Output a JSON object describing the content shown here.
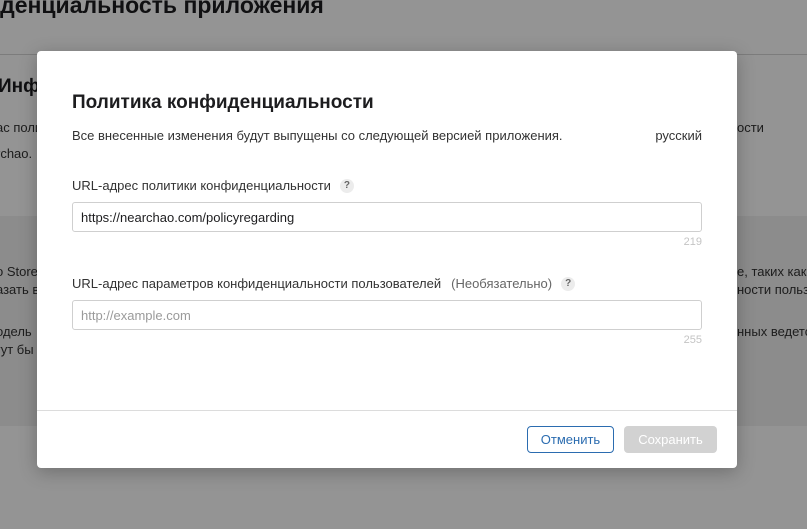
{
  "background": {
    "page_title": "иденциальность приложения",
    "section_title": "Инфо",
    "fragments_left": [
      "ас поли",
      "rchao.",
      "o Store",
      "азать в",
      "одель",
      "гут бы"
    ],
    "fragments_right": [
      "ости",
      "е, таких как",
      "ности польз",
      "нных ведетс"
    ]
  },
  "modal": {
    "title": "Политика конфиденциальности",
    "description": "Все внесенные изменения будут выпущены со следующей версией приложения.",
    "language": "русский",
    "field1": {
      "label": "URL-адрес политики конфиденциальности",
      "help": "?",
      "value": "https://nearchao.com/policyregarding",
      "counter": "219"
    },
    "field2": {
      "label": "URL-адрес параметров конфиденциальности пользователей",
      "optional": "(Необязательно)",
      "help": "?",
      "placeholder": "http://example.com",
      "counter": "255"
    },
    "cancel_label": "Отменить",
    "save_label": "Сохранить"
  }
}
